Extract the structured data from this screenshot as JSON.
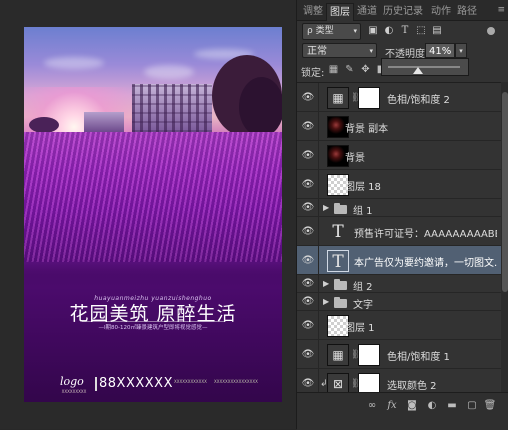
{
  "poster": {
    "pinyin": "huayuanmeizhu yuanzuishenghuo",
    "title": "花园美筑 原醉生活",
    "subtitle": "—I期80-120㎡臻景建筑户型即将视觉感觉—",
    "logo": "logo",
    "logo_small": "XXXXXXXXX",
    "phone": "88XXXXXX",
    "small_left": "XXXXXXXXXXXX",
    "small_right": "XXXXXXXXXXXXXXXX"
  },
  "panel": {
    "tabs": [
      "调整",
      "图层",
      "通道",
      "历史记录",
      "动作",
      "路径"
    ],
    "active_tab": "图层",
    "menu_icon": "≡",
    "filter_label": "ρ 类型",
    "blend_mode": "正常",
    "opacity_label": "不透明度:",
    "opacity_value": "41%",
    "opacity_fraction": 0.41,
    "lock_label": "锁定:",
    "layers": [
      {
        "name": "色相/饱和度 2",
        "kind": "adjustment",
        "eye": true
      },
      {
        "name": "背景 副本",
        "kind": "image",
        "eye": true
      },
      {
        "name": "背景",
        "kind": "image",
        "eye": true
      },
      {
        "name": "图层 18",
        "kind": "pixel",
        "eye": true
      },
      {
        "name": "组 1",
        "kind": "group",
        "eye": true
      },
      {
        "name": "预售许可证号：AAAAAAAAABBBBB...",
        "kind": "text",
        "eye": true
      },
      {
        "name": "本广告仅为要约邀请，一切图文...",
        "kind": "text",
        "eye": true,
        "selected": true
      },
      {
        "name": "组 2",
        "kind": "group",
        "eye": true
      },
      {
        "name": "文字",
        "kind": "group",
        "eye": true
      },
      {
        "name": "图层 1",
        "kind": "pixel",
        "eye": true
      },
      {
        "name": "色相/饱和度 1",
        "kind": "adjustment",
        "eye": true
      },
      {
        "name": "选取颜色 2",
        "kind": "adjustment-clipped",
        "eye": true
      }
    ],
    "footer_icons": [
      "link-icon",
      "fx-icon",
      "mask-icon",
      "adjustment-icon",
      "folder-icon",
      "new-layer-icon",
      "trash-icon"
    ]
  }
}
